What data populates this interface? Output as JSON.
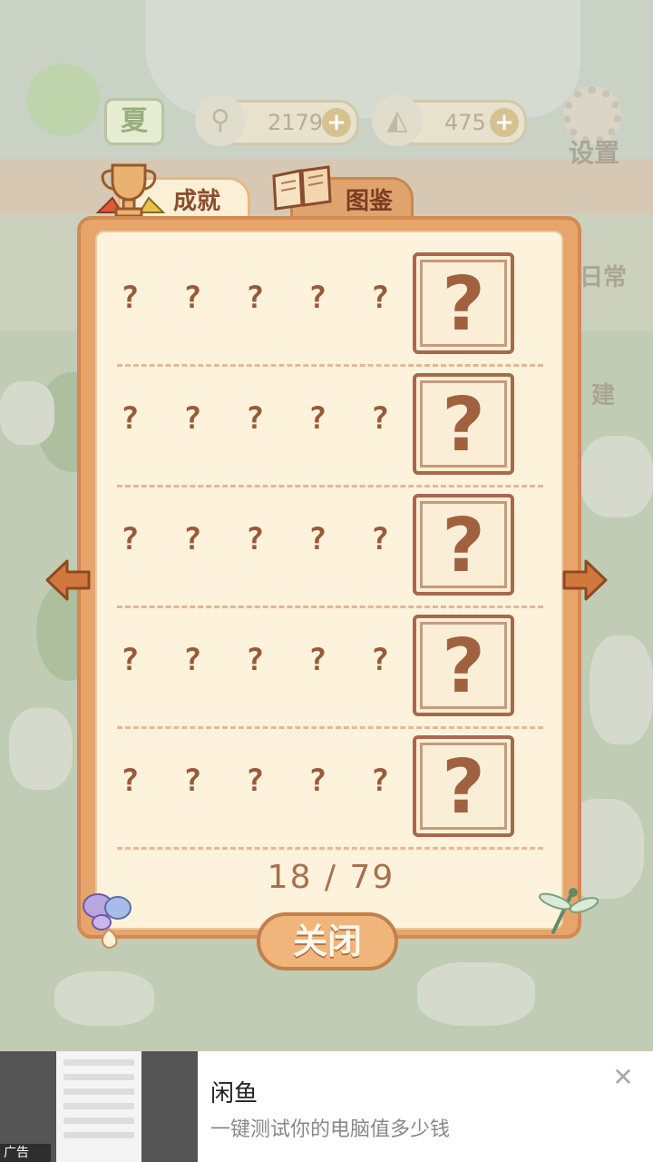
{
  "hud": {
    "season_label": "夏",
    "fish_amount": "2179K",
    "cheese_amount": "475",
    "plus_symbol": "+",
    "settings_label": "设置",
    "side_daily_label": "日常",
    "side_build_label": "建"
  },
  "dialog": {
    "tabs": {
      "achievements": "成就",
      "gallery": "图鉴"
    },
    "rows": [
      {
        "name": "? ? ? ? ?",
        "icon": "?"
      },
      {
        "name": "? ? ? ? ?",
        "icon": "?"
      },
      {
        "name": "? ? ? ? ?",
        "icon": "?"
      },
      {
        "name": "? ? ? ? ?",
        "icon": "?"
      },
      {
        "name": "? ? ? ? ?",
        "icon": "?"
      }
    ],
    "pager": "18 / 79",
    "close_label": "关闭"
  },
  "ad": {
    "tag": "广告",
    "title": "闲鱼",
    "description": "一键测试你的电脑值多少钱",
    "close_symbol": "✕"
  },
  "colors": {
    "frame": "#e7a46b",
    "paper": "#fdf3dc",
    "ink": "#9a5a38"
  }
}
